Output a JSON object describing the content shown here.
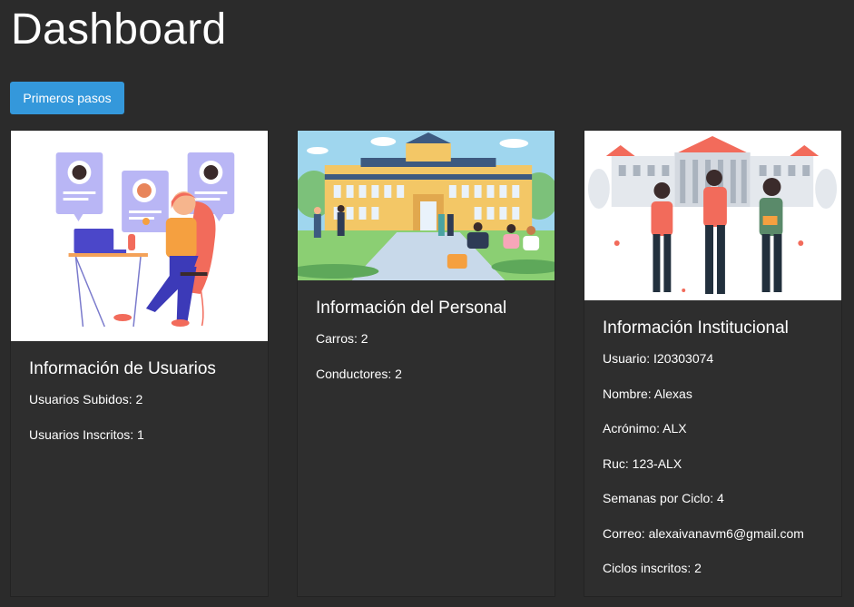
{
  "header": {
    "title": "Dashboard",
    "primary_button": "Primeros pasos"
  },
  "colors": {
    "background": "#2b2b2b",
    "card": "#2e2e2e",
    "button": "#3498db"
  },
  "cards": [
    {
      "title": "Información de Usuarios",
      "image_icon": "support-agent-illustration",
      "lines": [
        "Usuarios Subidos: 2",
        "Usuarios Inscritos: 1"
      ]
    },
    {
      "title": "Información del Personal",
      "image_icon": "campus-illustration",
      "lines": [
        "Carros: 2",
        "Conductores: 2"
      ]
    },
    {
      "title": "Información Institucional",
      "image_icon": "students-illustration",
      "lines": [
        "Usuario: I20303074",
        "Nombre: Alexas",
        "Acrónimo: ALX",
        "Ruc: 123-ALX",
        "Semanas por Ciclo: 4",
        "Correo: alexaivanavm6@gmail.com",
        "Ciclos inscritos: 2"
      ]
    }
  ]
}
